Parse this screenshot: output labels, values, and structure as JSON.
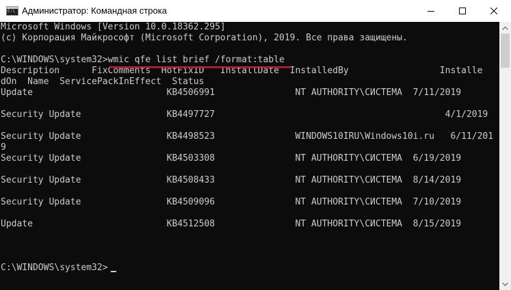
{
  "window": {
    "title": "Администратор: Командная строка",
    "icon": "cmd-icon"
  },
  "console": {
    "lines": [
      "Microsoft Windows [Version 10.0.18362.295]",
      "(c) Корпорация Майкрософт (Microsoft Corporation), 2019. Все права защищены.",
      "",
      "C:\\WINDOWS\\system32>wmic qfe list brief /format:table",
      "Description      FixComments  HotFixID   InstallDate  InstalledBy                 Installe",
      "dOn  Name  ServicePackInEffect  Status",
      "Update                         KB4506991               NT AUTHORITY\\СИСТЕМА  7/11/2019",
      "",
      "Security Update                KB4497727                                           4/1/2019",
      "",
      "Security Update                KB4498523               WINDOWS10IRU\\Windows10i.ru   6/11/201",
      "9",
      "Security Update                KB4503308               NT AUTHORITY\\СИСТЕМА  6/19/2019",
      "",
      "Security Update                KB4508433               NT AUTHORITY\\СИСТЕМА  8/14/2019",
      "",
      "Security Update                KB4509096               NT AUTHORITY\\СИСТЕМА  7/10/2019",
      "",
      "Update                         KB4512508               NT AUTHORITY\\СИСТЕМА  8/15/2019",
      "",
      "",
      "C:\\WINDOWS\\system32>"
    ],
    "text_color": "#cccccc",
    "background": "#0c0c0c",
    "highlight_color": "#e81123"
  }
}
